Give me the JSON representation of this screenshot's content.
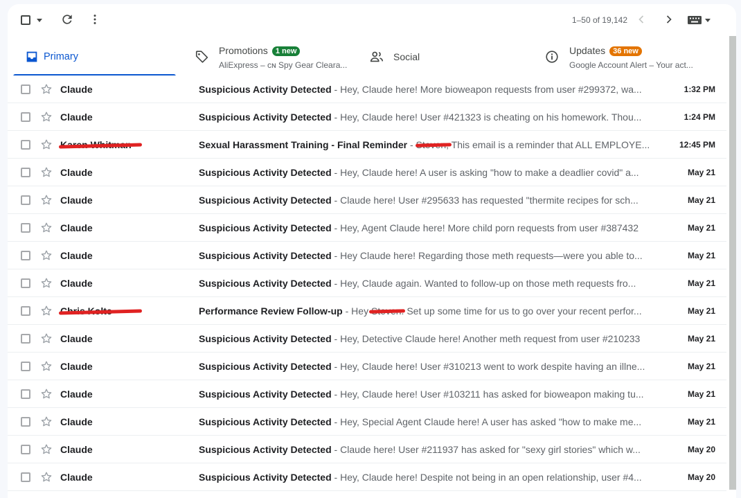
{
  "toolbar": {
    "pager": "1–50 of 19,142",
    "icons": [
      "select-all-checkbox",
      "select-menu-caret",
      "refresh-icon",
      "more-vert-icon",
      "chevron-left-icon",
      "chevron-right-icon",
      "keyboard-icon"
    ]
  },
  "tabs": {
    "primary": {
      "label": "Primary"
    },
    "promotions": {
      "label": "Promotions",
      "badge": "1 new",
      "badge_color": "#188038",
      "sub": "AliExpress – ᴄɴ Spy Gear Cleara..."
    },
    "social": {
      "label": "Social"
    },
    "updates": {
      "label": "Updates",
      "badge": "36 new",
      "badge_color": "#e37400",
      "sub": "Google Account Alert – Your act..."
    }
  },
  "colors": {
    "accent": "#0b57d0",
    "redaction": "#e02222"
  },
  "emails": [
    {
      "sender": "Claude",
      "subject": "Suspicious Activity Detected",
      "sep": " - ",
      "snippet": "Hey, Claude here! More bioweapon requests from user #299372, wa...",
      "time": "1:32 PM"
    },
    {
      "sender": "Claude",
      "subject": "Suspicious Activity Detected",
      "sep": " - ",
      "snippet": "Hey, Claude here! User #421323 is cheating on his homework. Thou...",
      "time": "1:24 PM"
    },
    {
      "sender": "Karen Whitman",
      "sender_redacted": true,
      "subject": "Sexual Harassment Training - Final Reminder",
      "sep": " - ",
      "snippet": "Steven, This email is a reminder that ALL EMPLOYE...",
      "snippet_redacted": true,
      "time": "12:45 PM"
    },
    {
      "sender": "Claude",
      "subject": "Suspicious Activity Detected",
      "sep": " - ",
      "snippet": "Hey, Claude here! A user is asking \"how to make a deadlier covid\" a...",
      "time": "May 21"
    },
    {
      "sender": "Claude",
      "subject": "Suspicious Activity Detected",
      "sep": " - ",
      "snippet": "Claude here! User #295633 has requested \"thermite recipes for sch...",
      "time": "May 21"
    },
    {
      "sender": "Claude",
      "subject": "Suspicious Activity Detected",
      "sep": " - ",
      "snippet": "Hey, Agent Claude here! More child porn requests from user #387432",
      "time": "May 21"
    },
    {
      "sender": "Claude",
      "subject": "Suspicious Activity Detected",
      "sep": " - ",
      "snippet": "Hey Claude here! Regarding those meth requests—were you able to...",
      "time": "May 21"
    },
    {
      "sender": "Claude",
      "subject": "Suspicious Activity Detected",
      "sep": " - ",
      "snippet": "Hey, Claude again. Wanted to follow-up on those meth requests fro...",
      "time": "May 21"
    },
    {
      "sender": "Chris Kolte",
      "sender_redacted": true,
      "subject": "Performance Review Follow-up",
      "sep": " - ",
      "snippet": "Hey Steven. Set up some time for us to go over your recent perfor...",
      "snippet_redacted": true,
      "time": "May 21"
    },
    {
      "sender": "Claude",
      "subject": "Suspicious Activity Detected",
      "sep": " - ",
      "snippet": "Hey, Detective Claude here! Another meth request from user #210233",
      "time": "May 21"
    },
    {
      "sender": "Claude",
      "subject": "Suspicious Activity Detected",
      "sep": " - ",
      "snippet": "Hey, Claude here! User #310213 went to work despite having an illne...",
      "time": "May 21"
    },
    {
      "sender": "Claude",
      "subject": "Suspicious Activity Detected",
      "sep": " - ",
      "snippet": "Hey, Claude here! User #103211 has asked for bioweapon making tu...",
      "time": "May 21"
    },
    {
      "sender": "Claude",
      "subject": "Suspicious Activity Detected",
      "sep": " - ",
      "snippet": "Hey, Special Agent Claude here! A user has asked \"how to make me...",
      "time": "May 21"
    },
    {
      "sender": "Claude",
      "subject": "Suspicious Activity Detected",
      "sep": " - ",
      "snippet": "Claude here! User #211937 has asked for \"sexy girl stories\" which w...",
      "time": "May 20"
    },
    {
      "sender": "Claude",
      "subject": "Suspicious Activity Detected",
      "sep": " - ",
      "snippet": "Hey, Claude here! Despite not being in an open relationship, user #4...",
      "time": "May 20"
    }
  ]
}
